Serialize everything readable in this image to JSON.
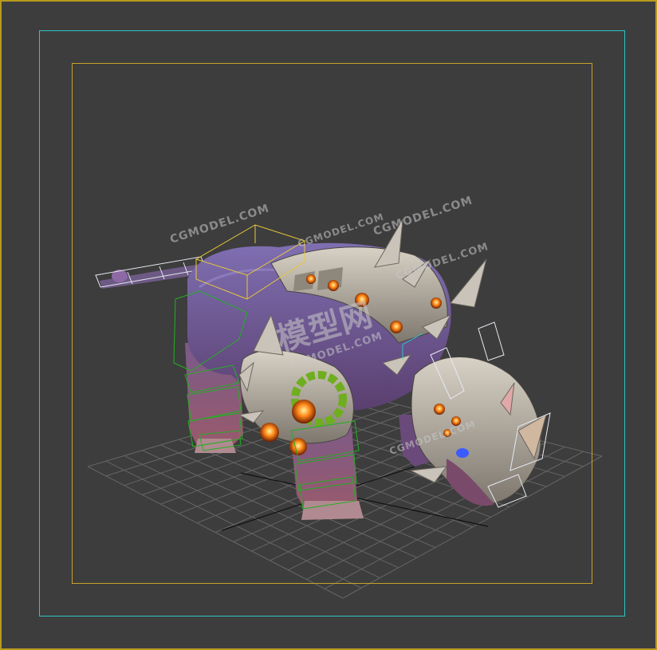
{
  "viewport": {
    "name": "perspective-viewport",
    "background": "#3d3d3d",
    "safe_frame_outer_color": "#2ec4c4",
    "safe_frame_inner_color": "#c8a22a",
    "border_color": "#b89a1e",
    "grid_color": "#6a6a6a",
    "axis_color": "#111111"
  },
  "watermark": {
    "main_text": "模型网",
    "repeated_text": "CGMODEL.COM"
  },
  "model": {
    "subject": "armored-rhino-creature",
    "body_color": "#6a5a9a",
    "armor_color": "#b9b1a6",
    "gem_color": "#ff8a1a",
    "gear_color": "#6fae1e",
    "bone_box_green": "#22b022",
    "bone_box_yellow": "#e8c83a",
    "bone_box_white": "#e6eaf2"
  }
}
